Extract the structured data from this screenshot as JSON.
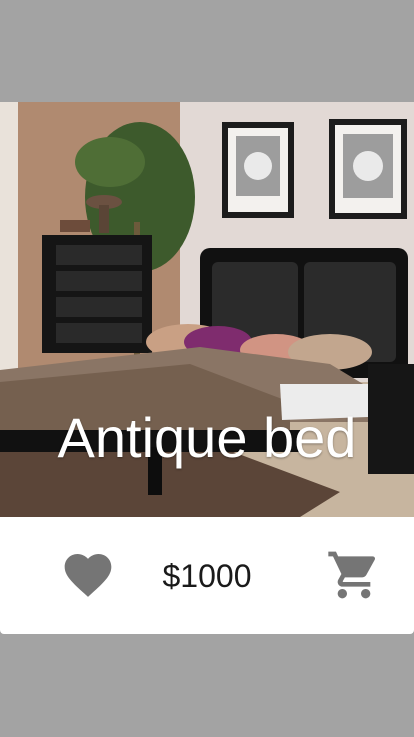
{
  "product": {
    "title": "Antique bed",
    "price": "$1000",
    "image": "bedroom-photo"
  },
  "actions": {
    "favorite_icon": "heart-icon",
    "cart_icon": "cart-icon",
    "icon_color": "#757575"
  }
}
